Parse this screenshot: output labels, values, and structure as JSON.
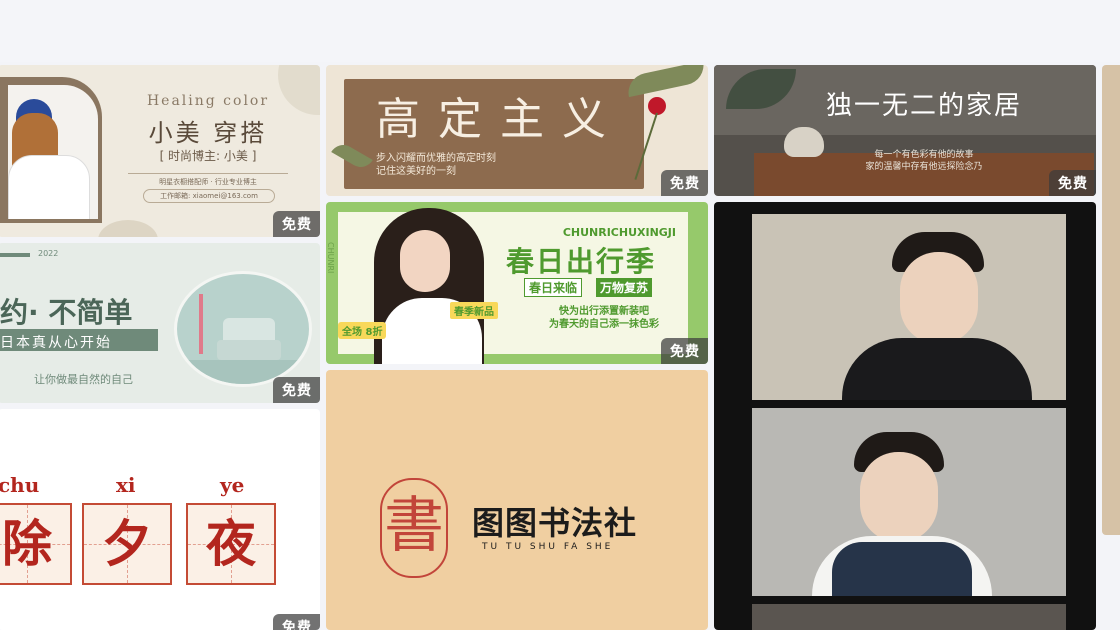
{
  "badge": "免费",
  "cards": {
    "healing": {
      "eng": "Healing color",
      "title": "小美 穿搭",
      "blogger": "[ 时尚博主: 小美 ]",
      "line1": "明星衣橱搭配师 · 行业专业博主",
      "email": "工作邮箱: xiaomei@163.com"
    },
    "gaoding": {
      "title": "高定主义",
      "line1": "步入闪耀而优雅的高定时刻",
      "line2": "记住这美好的一刻"
    },
    "jiaju": {
      "title": "独一无二的家居",
      "line1": "每一个有色彩有他的故事",
      "line2": "家的温馨中存有他远探险念乃"
    },
    "jianyue": {
      "top": "2022",
      "title": "约· 不简单",
      "sub": "日本真从心开始",
      "foot": "让你做最自然的自己"
    },
    "chunri": {
      "pinyin": "CHUNRICHUXINGJI",
      "title": "春日出行季",
      "tag1": "春日来临",
      "tag2": "万物复苏",
      "new": "春季新品",
      "l1": "快为出行添置新装吧",
      "l2": "为春天的自己添一抹色彩",
      "discount": "全场 8折",
      "side": "CHUNRI"
    },
    "chuxi": {
      "py1": "chu",
      "py2": "xi",
      "py3": "ye",
      "c1": "除",
      "c2": "夕",
      "c3": "夜"
    },
    "shufa": {
      "seal": "書",
      "name": "图图书法社",
      "pinyin": "TU TU SHU FA SHE"
    }
  },
  "colors": {
    "red": "#b3261e",
    "green": "#4f9a2e",
    "brown": "#8d6b4e"
  }
}
